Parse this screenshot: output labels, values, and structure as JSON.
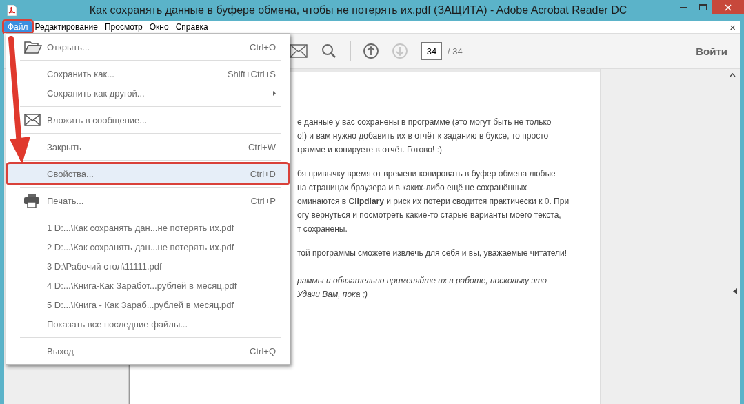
{
  "window": {
    "title": "Как сохранять данные в буфере обмена, чтобы не потерять их.pdf (ЗАЩИТА) - Adobe Acrobat Reader DC"
  },
  "menubar": [
    {
      "label": "Файл",
      "selected": true,
      "marked": true
    },
    {
      "label": "Редактирование",
      "selected": false,
      "marked": false
    },
    {
      "label": "Просмотр",
      "selected": false,
      "marked": false
    },
    {
      "label": "Окно",
      "selected": false,
      "marked": false
    },
    {
      "label": "Справка",
      "selected": false,
      "marked": false
    }
  ],
  "close_document": "×",
  "toolbar": {
    "next_page_disabled": true,
    "page": "34",
    "total": "/ 34",
    "sign_in": "Войти"
  },
  "menu": {
    "groups": [
      {
        "items": [
          {
            "label": "Открыть...",
            "shortcut": "Ctrl+O",
            "submenu": false,
            "selected": false,
            "marked": false
          }
        ]
      },
      {
        "items": [
          {
            "label": "Сохранить как...",
            "shortcut": "Shift+Ctrl+S",
            "submenu": false,
            "selected": false,
            "marked": false
          },
          {
            "label": "Сохранить как другой...",
            "submenu": true,
            "selected": false,
            "marked": false
          }
        ]
      },
      {
        "items": [
          {
            "label": "Вложить в сообщение...",
            "submenu": false,
            "selected": false,
            "marked": false
          }
        ]
      },
      {
        "items": [
          {
            "label": "Закрыть",
            "shortcut": "Ctrl+W",
            "submenu": false,
            "selected": false,
            "marked": false
          }
        ]
      },
      {
        "items": [
          {
            "label": "Свойства...",
            "shortcut": "Ctrl+D",
            "submenu": false,
            "selected": true,
            "marked": true
          }
        ]
      },
      {
        "items": [
          {
            "label": "Печать...",
            "shortcut": "Ctrl+P",
            "submenu": false,
            "selected": false,
            "marked": false
          }
        ]
      },
      {
        "items": [
          {
            "label": "1 D:...\\Как сохранять дан...не потерять их.pdf",
            "submenu": false,
            "selected": false,
            "marked": false
          },
          {
            "label": "2 D:...\\Как сохранять дан...не потерять их.pdf",
            "submenu": false,
            "selected": false,
            "marked": false
          },
          {
            "label": "3 D:\\Рабочий стол\\11111.pdf",
            "submenu": false,
            "selected": false,
            "marked": false
          },
          {
            "label": "4 D:...\\Книга-Как Заработ...рублей в месяц.pdf",
            "submenu": false,
            "selected": false,
            "marked": false
          },
          {
            "label": "5 D:...\\Книга - Как Зараб...рублей в месяц.pdf",
            "submenu": false,
            "selected": false,
            "marked": false
          },
          {
            "label": "Показать все последние файлы...",
            "submenu": false,
            "selected": false,
            "marked": false
          }
        ]
      },
      {
        "items": [
          {
            "label": "Выход",
            "shortcut": "Ctrl+Q",
            "submenu": false,
            "selected": false,
            "marked": false
          }
        ]
      }
    ]
  },
  "document": {
    "paragraphs": [
      {
        "italic": false,
        "lines": [
          "е данные у вас сохранены в программе (это могут быть не только",
          "о!) и вам нужно добавить их в отчёт к заданию в буксе, то просто",
          "грамме и копируете в отчёт. Готово! :)"
        ]
      },
      {
        "italic": false,
        "lines": [
          "бя привычку время от времени копировать в буфер обмена любые",
          "на страницах браузера и в каких-либо ещё не сохранённых",
          "оминаются в **Clipdiary** и риск их потери сводится практически к 0. При",
          "огу вернуться и посмотреть какие-то старые варианты моего текста,",
          "т сохранены."
        ]
      },
      {
        "italic": false,
        "lines": [
          "той программы сможете извлечь для себя и вы, уважаемые читатели!"
        ]
      },
      {
        "italic": true,
        "lines": [
          "раммы и обязательно применяйте их в работе, поскольку это",
          "Удачи Вам, пока ;)"
        ]
      }
    ]
  }
}
